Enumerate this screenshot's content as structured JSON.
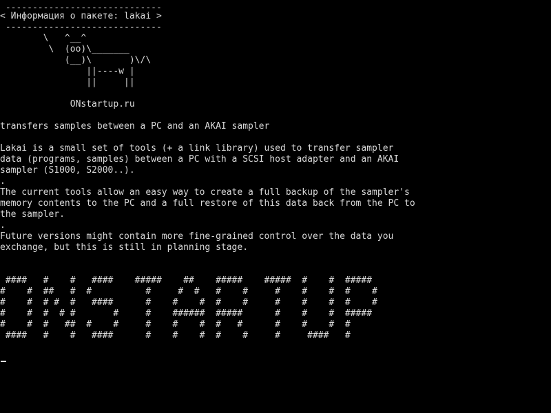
{
  "terminal": {
    "lines": [
      " -----------------------------",
      "< Информация о пакете: lakai >",
      " -----------------------------",
      "        \\   ^__^",
      "         \\  (oo)\\_______",
      "            (__)\\       )\\/\\",
      "                ||----w |",
      "                ||     ||",
      "",
      "             ONstartup.ru",
      "",
      "transfers samples between a PC and an AKAI sampler",
      "",
      "Lakai is a small set of tools (+ a link library) used to transfer sampler",
      "data (programs, samples) between a PC with a SCSI host adapter and an AKAI",
      "sampler (S1000, S2000..).",
      ".",
      "The current tools allow an easy way to create a full backup of the sampler's",
      "memory contents to the PC and a full restore of this data back from the PC to",
      "the sampler.",
      ".",
      "Future versions might contain more fine-grained control over the data you",
      "exchange, but this is still in planning stage.",
      "",
      "",
      " ####   #    #   ####    #####    ##    #####    #####  #    #  #####",
      "#    #  ##   #  #          #     #  #   #    #     #    #    #  #    #",
      "#    #  # #  #   ####      #    #    #  #    #     #    #    #  #    #",
      "#    #  #  # #       #     #    ######  #####      #    #    #  #####",
      "#    #  #   ##  #    #     #    #    #  #   #      #    #    #  #",
      " ####   #    #   ####      #    #    #  #    #     #     ####   #"
    ]
  }
}
